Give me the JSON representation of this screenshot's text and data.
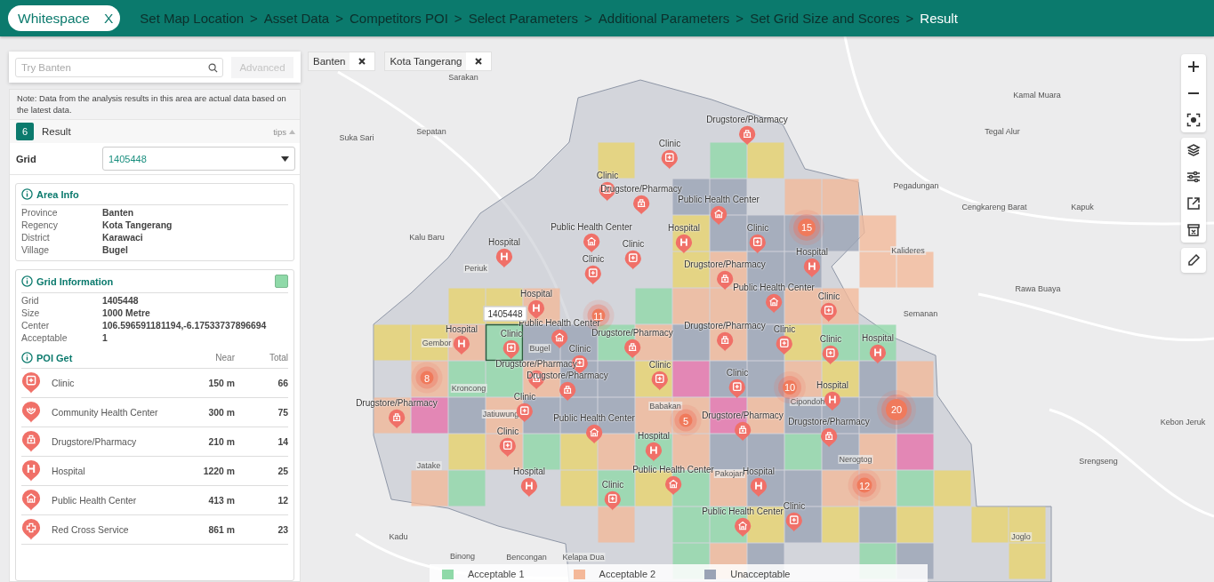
{
  "top_bar": {
    "app_chip": {
      "label": "Whitespace",
      "close_label": "X"
    },
    "steps": [
      {
        "label": "Set Map Location",
        "current": false
      },
      {
        "label": "Asset Data",
        "prefix": ">",
        "current": false
      },
      {
        "label": "Competitors POI",
        "prefix": ">",
        "current": false
      },
      {
        "label": "Select Parameters",
        "prefix": ">",
        "current": false
      },
      {
        "label": "Additional Parameters",
        "prefix": ">",
        "current": false
      },
      {
        "label": "Set Grid Size and Scores",
        "prefix": ">",
        "current": false
      },
      {
        "label": "Result",
        "prefix": ">",
        "current": true
      }
    ]
  },
  "sidebar": {
    "search": {
      "placeholder": "Try Banten"
    },
    "advanced_button": "Advanced",
    "note": "Note: Data from the analysis results in this area are actual data based on the latest data.",
    "result": {
      "step": "6",
      "title": "Result",
      "tips": "tips"
    },
    "grid_select": {
      "label": "Grid",
      "value": "1405448"
    },
    "area_info": {
      "title": "Area Info",
      "rows": [
        {
          "label": "Province",
          "value": "Banten"
        },
        {
          "label": "Regency",
          "value": "Kota Tangerang"
        },
        {
          "label": "District",
          "value": "Karawaci"
        },
        {
          "label": "Village",
          "value": "Bugel"
        }
      ]
    },
    "grid_info": {
      "title": "Grid Information",
      "rows": [
        {
          "label": "Grid",
          "value": "1405448"
        },
        {
          "label": "Size",
          "value": "1000 Metre"
        },
        {
          "label": "Center",
          "value": "106.596591181194,-6.17533737896694"
        },
        {
          "label": "Acceptable",
          "value": "1"
        }
      ]
    },
    "poi": {
      "title": "POI Get",
      "near_header": "Near",
      "total_header": "Total",
      "rows": [
        {
          "kind": "clinic",
          "name": "Clinic",
          "near": "150 m",
          "total": "66"
        },
        {
          "kind": "community",
          "name": "Community Health Center",
          "near": "300 m",
          "total": "75"
        },
        {
          "kind": "pharmacy",
          "name": "Drugstore/Pharmacy",
          "near": "210 m",
          "total": "14"
        },
        {
          "kind": "hospital",
          "name": "Hospital",
          "near": "1220 m",
          "total": "25"
        },
        {
          "kind": "health-center",
          "name": "Public Health Center",
          "near": "413 m",
          "total": "12"
        },
        {
          "kind": "red-cross",
          "name": "Red Cross Service",
          "near": "861 m",
          "total": "23"
        }
      ]
    }
  },
  "map": {
    "filters": [
      {
        "label": "Banten"
      },
      {
        "label": "Kota Tangerang"
      }
    ],
    "grid_rows": [
      {
        "cells": [
          {
            "kind": "empty"
          },
          {
            "kind": "empty"
          },
          {
            "kind": "empty"
          },
          {
            "kind": "empty"
          },
          {
            "kind": "empty"
          },
          {
            "kind": "empty"
          },
          {
            "kind": "score3",
            "selected": false
          },
          {
            "kind": "empty"
          },
          {
            "kind": "empty"
          },
          {
            "kind": "accept1",
            "selected": false
          },
          {
            "kind": "score3",
            "selected": false
          }
        ]
      },
      {
        "cells": [
          {
            "kind": "empty"
          },
          {
            "kind": "empty"
          },
          {
            "kind": "empty"
          },
          {
            "kind": "empty"
          },
          {
            "kind": "empty"
          },
          {
            "kind": "empty"
          },
          {
            "kind": "empty"
          },
          {
            "kind": "empty"
          },
          {
            "kind": "unaccept",
            "selected": false
          },
          {
            "kind": "unaccept",
            "selected": false
          },
          {
            "kind": "empty"
          },
          {
            "kind": "accept2",
            "selected": false
          },
          {
            "kind": "accept2",
            "selected": false
          }
        ]
      },
      {
        "cells": [
          {
            "kind": "empty"
          },
          {
            "kind": "empty"
          },
          {
            "kind": "empty"
          },
          {
            "kind": "empty"
          },
          {
            "kind": "empty"
          },
          {
            "kind": "empty"
          },
          {
            "kind": "empty"
          },
          {
            "kind": "empty"
          },
          {
            "kind": "score3",
            "selected": false
          },
          {
            "kind": "unaccept",
            "selected": false
          },
          {
            "kind": "unaccept",
            "selected": false
          },
          {
            "kind": "unaccept",
            "selected": false
          },
          {
            "kind": "unaccept",
            "selected": false
          },
          {
            "kind": "accept2",
            "selected": false
          }
        ]
      },
      {
        "cells": [
          {
            "kind": "empty"
          },
          {
            "kind": "empty"
          },
          {
            "kind": "empty"
          },
          {
            "kind": "empty"
          },
          {
            "kind": "empty"
          },
          {
            "kind": "empty"
          },
          {
            "kind": "empty"
          },
          {
            "kind": "empty"
          },
          {
            "kind": "score3",
            "selected": false
          },
          {
            "kind": "accept2",
            "selected": false
          },
          {
            "kind": "unaccept",
            "selected": false
          },
          {
            "kind": "unaccept",
            "selected": false
          },
          {
            "kind": "empty"
          },
          {
            "kind": "accept2",
            "selected": false
          },
          {
            "kind": "accept2",
            "selected": false
          }
        ]
      },
      {
        "cells": [
          {
            "kind": "empty"
          },
          {
            "kind": "empty"
          },
          {
            "kind": "score3",
            "selected": false
          },
          {
            "kind": "score3",
            "selected": false
          },
          {
            "kind": "accept2",
            "selected": false
          },
          {
            "kind": "empty"
          },
          {
            "kind": "empty"
          },
          {
            "kind": "accept1",
            "selected": false
          },
          {
            "kind": "accept2",
            "selected": false
          },
          {
            "kind": "accept2",
            "selected": false
          },
          {
            "kind": "unaccept",
            "selected": false
          },
          {
            "kind": "accept2",
            "selected": false
          },
          {
            "kind": "accept2",
            "selected": false
          }
        ]
      },
      {
        "cells": [
          {
            "kind": "score3",
            "selected": false
          },
          {
            "kind": "score3",
            "selected": false
          },
          {
            "kind": "accept2",
            "selected": false
          },
          {
            "kind": "accept1",
            "selected": true
          },
          {
            "kind": "unaccept",
            "selected": false
          },
          {
            "kind": "unaccept",
            "selected": false
          },
          {
            "kind": "accept1",
            "selected": false
          },
          {
            "kind": "accept2",
            "selected": false
          },
          {
            "kind": "unaccept",
            "selected": false
          },
          {
            "kind": "accept2",
            "selected": false
          },
          {
            "kind": "unaccept",
            "selected": false
          },
          {
            "kind": "score3",
            "selected": false
          },
          {
            "kind": "accept1",
            "selected": false
          },
          {
            "kind": "accept1",
            "selected": false
          }
        ]
      },
      {
        "cells": [
          {
            "kind": "empty"
          },
          {
            "kind": "accept2",
            "selected": false
          },
          {
            "kind": "accept1",
            "selected": false
          },
          {
            "kind": "accept1",
            "selected": false
          },
          {
            "kind": "accept2",
            "selected": false
          },
          {
            "kind": "unaccept",
            "selected": false
          },
          {
            "kind": "unaccept",
            "selected": false
          },
          {
            "kind": "score3",
            "selected": false
          },
          {
            "kind": "score4",
            "selected": false
          },
          {
            "kind": "unaccept",
            "selected": false
          },
          {
            "kind": "unaccept",
            "selected": false
          },
          {
            "kind": "accept2",
            "selected": false
          },
          {
            "kind": "score3",
            "selected": false
          },
          {
            "kind": "unaccept",
            "selected": false
          },
          {
            "kind": "accept2",
            "selected": false
          }
        ]
      },
      {
        "cells": [
          {
            "kind": "accept2",
            "selected": false
          },
          {
            "kind": "score4",
            "selected": false
          },
          {
            "kind": "unaccept",
            "selected": false
          },
          {
            "kind": "accept2",
            "selected": false
          },
          {
            "kind": "unaccept",
            "selected": false
          },
          {
            "kind": "unaccept",
            "selected": false
          },
          {
            "kind": "unaccept",
            "selected": false
          },
          {
            "kind": "accept2",
            "selected": false
          },
          {
            "kind": "accept2",
            "selected": false
          },
          {
            "kind": "score4",
            "selected": false
          },
          {
            "kind": "accept2",
            "selected": false
          },
          {
            "kind": "unaccept",
            "selected": false
          },
          {
            "kind": "unaccept",
            "selected": false
          },
          {
            "kind": "unaccept",
            "selected": false
          },
          {
            "kind": "unaccept",
            "selected": false
          }
        ]
      },
      {
        "cells": [
          {
            "kind": "empty"
          },
          {
            "kind": "empty"
          },
          {
            "kind": "score3",
            "selected": false
          },
          {
            "kind": "accept2",
            "selected": false
          },
          {
            "kind": "accept1",
            "selected": false
          },
          {
            "kind": "score3",
            "selected": false
          },
          {
            "kind": "accept2",
            "selected": false
          },
          {
            "kind": "accept1",
            "selected": false
          },
          {
            "kind": "accept2",
            "selected": false
          },
          {
            "kind": "unaccept",
            "selected": false
          },
          {
            "kind": "unaccept",
            "selected": false
          },
          {
            "kind": "accept1",
            "selected": false
          },
          {
            "kind": "unaccept",
            "selected": false
          },
          {
            "kind": "accept2",
            "selected": false
          },
          {
            "kind": "score4",
            "selected": false
          }
        ]
      },
      {
        "cells": [
          {
            "kind": "empty"
          },
          {
            "kind": "accept2",
            "selected": false
          },
          {
            "kind": "accept1",
            "selected": false
          },
          {
            "kind": "empty"
          },
          {
            "kind": "empty"
          },
          {
            "kind": "score3",
            "selected": false
          },
          {
            "kind": "accept1",
            "selected": false
          },
          {
            "kind": "score3",
            "selected": false
          },
          {
            "kind": "accept1",
            "selected": false
          },
          {
            "kind": "accept2",
            "selected": false
          },
          {
            "kind": "unaccept",
            "selected": false
          },
          {
            "kind": "unaccept",
            "selected": false
          },
          {
            "kind": "accept2",
            "selected": false
          },
          {
            "kind": "accept2",
            "selected": false
          },
          {
            "kind": "accept1",
            "selected": false
          },
          {
            "kind": "score3",
            "selected": false
          }
        ]
      },
      {
        "cells": [
          {
            "kind": "empty"
          },
          {
            "kind": "empty"
          },
          {
            "kind": "empty"
          },
          {
            "kind": "empty"
          },
          {
            "kind": "empty"
          },
          {
            "kind": "empty"
          },
          {
            "kind": "accept2",
            "selected": false
          },
          {
            "kind": "empty"
          },
          {
            "kind": "accept1",
            "selected": false
          },
          {
            "kind": "accept1",
            "selected": false
          },
          {
            "kind": "score3",
            "selected": false
          },
          {
            "kind": "unaccept",
            "selected": false
          },
          {
            "kind": "score3",
            "selected": false
          },
          {
            "kind": "unaccept",
            "selected": false
          },
          {
            "kind": "score3",
            "selected": false
          },
          {
            "kind": "empty"
          },
          {
            "kind": "score3",
            "selected": false
          },
          {
            "kind": "score3",
            "selected": false
          }
        ]
      },
      {
        "cells": [
          {
            "kind": "empty"
          },
          {
            "kind": "empty"
          },
          {
            "kind": "empty"
          },
          {
            "kind": "empty"
          },
          {
            "kind": "empty"
          },
          {
            "kind": "empty"
          },
          {
            "kind": "empty"
          },
          {
            "kind": "empty"
          },
          {
            "kind": "accept1",
            "selected": false
          },
          {
            "kind": "accept2",
            "selected": false
          },
          {
            "kind": "unaccept",
            "selected": false
          },
          {
            "kind": "empty"
          },
          {
            "kind": "empty"
          },
          {
            "kind": "accept1",
            "selected": false
          },
          {
            "kind": "unaccept",
            "selected": false
          },
          {
            "kind": "empty"
          },
          {
            "kind": "empty"
          },
          {
            "kind": "score3",
            "selected": false
          }
        ]
      }
    ],
    "selected_tooltip": "1405448",
    "places": [
      "Sarakan",
      "Suka Sari",
      "Sepatan",
      "Kalu Baru",
      "Periuk",
      "Gembor",
      "Kroncong",
      "Jatake",
      "Kadu",
      "Binong",
      "Bencongan",
      "Kelapa Dua",
      "Jatiuwung",
      "Bugel",
      "Babakan",
      "Pakojan",
      "Cipondoh",
      "Nerogtog",
      "Kalideres",
      "Semanan",
      "Rawa Buaya",
      "Pegadungan",
      "Cengkareng Barat",
      "Kapuk",
      "Tegal Alur",
      "Kamal Muara",
      "Kebon Jeruk",
      "Srengseng",
      "Joglo"
    ],
    "markers": [
      {
        "kind": "pharmacy",
        "label": "Drugstore/Pharmacy"
      },
      {
        "kind": "clinic",
        "label": "Clinic"
      },
      {
        "kind": "clinic",
        "label": "Clinic"
      },
      {
        "kind": "pharmacy",
        "label": "Drugstore/Pharmacy"
      },
      {
        "kind": "health-center",
        "label": "Public Health Center"
      },
      {
        "kind": "health-center",
        "label": "Public Health Center"
      },
      {
        "kind": "clinic",
        "label": "Clinic"
      },
      {
        "kind": "hospital",
        "label": "Hospital"
      },
      {
        "kind": "clinic",
        "label": "Clinic"
      },
      {
        "kind": "hospital",
        "label": "Hospital"
      },
      {
        "kind": "clinic",
        "label": "Clinic"
      },
      {
        "kind": "pharmacy",
        "label": "Drugstore/Pharmacy"
      },
      {
        "kind": "hospital",
        "label": "Hospital"
      },
      {
        "kind": "health-center",
        "label": "Public Health Center"
      },
      {
        "kind": "hospital",
        "label": "Hospital"
      },
      {
        "kind": "clinic",
        "label": "Clinic"
      },
      {
        "kind": "health-center",
        "label": "Public Health Center"
      },
      {
        "kind": "pharmacy",
        "label": "Drugstore/Pharmacy"
      },
      {
        "kind": "hospital",
        "label": "Hospital"
      },
      {
        "kind": "clinic",
        "label": "Clinic"
      },
      {
        "kind": "pharmacy",
        "label": "Drugstore/Pharmacy"
      },
      {
        "kind": "clinic",
        "label": "Clinic"
      },
      {
        "kind": "clinic",
        "label": "Clinic"
      },
      {
        "kind": "clinic",
        "label": "Clinic"
      },
      {
        "kind": "hospital",
        "label": "Hospital"
      },
      {
        "kind": "pharmacy",
        "label": "Drugstore/Pharmacy"
      },
      {
        "kind": "pharmacy",
        "label": "Drugstore/Pharmacy"
      },
      {
        "kind": "clinic",
        "label": "Clinic"
      },
      {
        "kind": "clinic",
        "label": "Clinic"
      },
      {
        "kind": "hospital",
        "label": "Hospital"
      },
      {
        "kind": "pharmacy",
        "label": "Drugstore/Pharmacy"
      },
      {
        "kind": "clinic",
        "label": "Clinic"
      },
      {
        "kind": "health-center",
        "label": "Public Health Center"
      },
      {
        "kind": "pharmacy",
        "label": "Drugstore/Pharmacy"
      },
      {
        "kind": "pharmacy",
        "label": "Drugstore/Pharmacy"
      },
      {
        "kind": "clinic",
        "label": "Clinic"
      },
      {
        "kind": "hospital",
        "label": "Hospital"
      },
      {
        "kind": "hospital",
        "label": "Hospital"
      },
      {
        "kind": "health-center",
        "label": "Public Health Center"
      },
      {
        "kind": "hospital",
        "label": "Hospital"
      },
      {
        "kind": "clinic",
        "label": "Clinic"
      },
      {
        "kind": "health-center",
        "label": "Public Health Center"
      },
      {
        "kind": "clinic",
        "label": "Clinic"
      }
    ],
    "clusters": [
      "15",
      "11",
      "8",
      "10",
      "5",
      "20",
      "12"
    ],
    "legend": [
      {
        "label": "Acceptable 1",
        "color": "#8fd9a8"
      },
      {
        "label": "Acceptable 2",
        "color": "#f4b899"
      },
      {
        "label": "Unacceptable",
        "color": "#9aa3b5"
      }
    ]
  }
}
